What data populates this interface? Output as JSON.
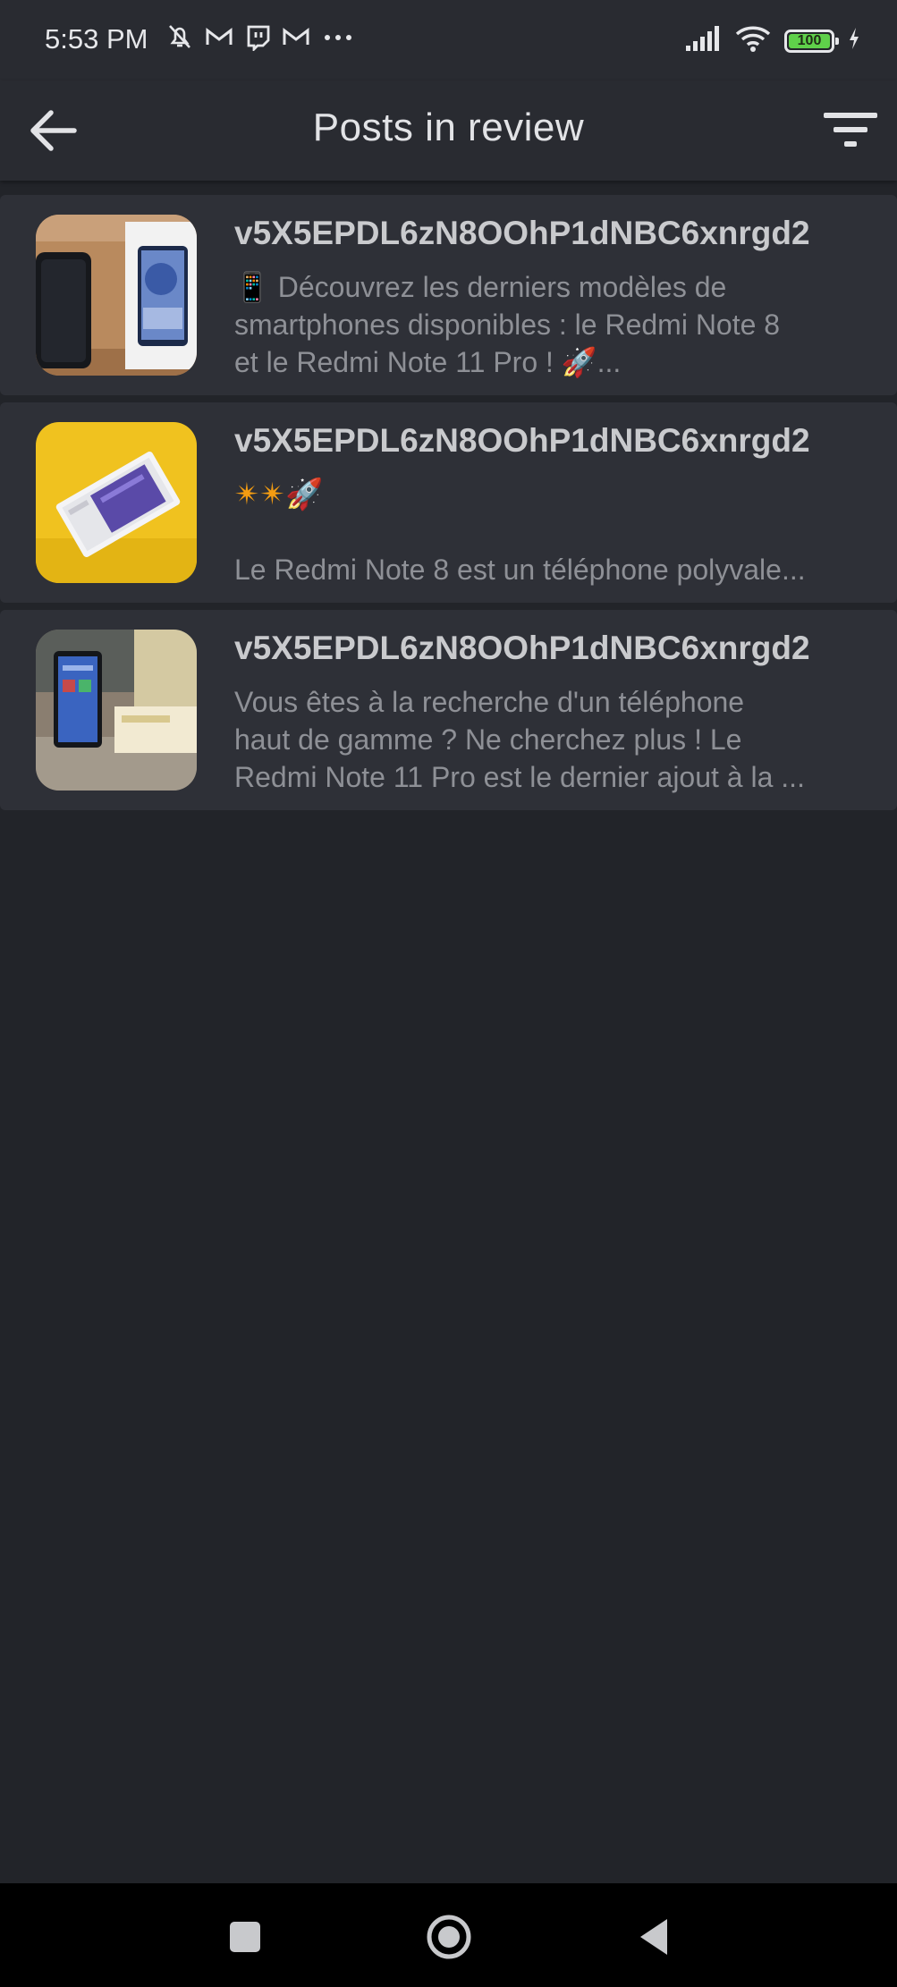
{
  "status_bar": {
    "time": "5:53 PM",
    "left_icons": [
      "alarm-off-icon",
      "mail-icon",
      "twitch-icon",
      "mail-icon",
      "more-dots-icon"
    ],
    "right_icons": [
      "signal-icon",
      "wifi-icon",
      "battery-icon",
      "charging-icon"
    ],
    "battery_level": "100",
    "battery_color": "#5fd04a"
  },
  "app_bar": {
    "title": "Posts in review",
    "back_icon": "arrow-back-icon",
    "filter_icon": "filter-icon"
  },
  "posts": [
    {
      "author": "v5X5EPDL6zN8OOhP1dNBC6xnrgd2",
      "lines": [
        "📱 Découvrez les derniers modèles de",
        "smartphones disponibles : le Redmi Note 8",
        "et le Redmi Note 11 Pro ! 🚀..."
      ],
      "thumbnail": "phone-box-thumbnail"
    },
    {
      "author": "v5X5EPDL6zN8OOhP1dNBC6xnrgd2",
      "emoji": "✴✴🚀",
      "lines": [
        "Le Redmi Note 8 est un téléphone polyvale..."
      ],
      "thumbnail": "phone-box-yellow-thumbnail"
    },
    {
      "author": "v5X5EPDL6zN8OOhP1dNBC6xnrgd2",
      "lines": [
        "Vous êtes à la recherche d'un téléphone",
        "haut de gamme ? Ne cherchez plus ! Le",
        "Redmi Note 11 Pro est le dernier ajout à la ..."
      ],
      "thumbnail": "phone-on-table-thumbnail"
    }
  ],
  "nav_bar": {
    "buttons": [
      "recent-apps-icon",
      "home-icon",
      "back-triangle-icon"
    ]
  },
  "colors": {
    "background": "#222429",
    "card": "#2e3037",
    "app_bar": "#292b31",
    "author_text": "#c9cacd",
    "excerpt_text": "#8e9096"
  }
}
